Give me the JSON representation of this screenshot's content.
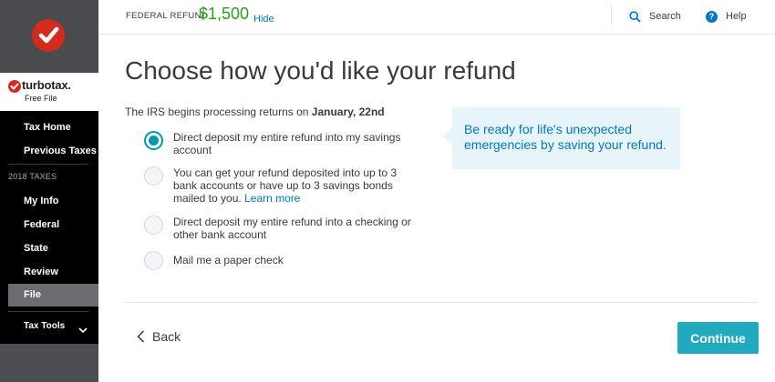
{
  "header": {
    "refund_label": "FEDERAL REFUND",
    "refund_amount": "$1,500",
    "hide_label": "Hide",
    "search_label": "Search",
    "help_label": "Help",
    "refund_color": "#2ca01c"
  },
  "sidebar": {
    "brand_name": "turbotax.",
    "brand_sub": "Free File",
    "items": [
      {
        "label": "Tax Home"
      },
      {
        "label": "Previous Taxes"
      }
    ],
    "section_label": "2018 TAXES",
    "section_items": [
      {
        "label": "My Info"
      },
      {
        "label": "Federal"
      },
      {
        "label": "State"
      },
      {
        "label": "Review"
      },
      {
        "label": "File",
        "active": true
      }
    ],
    "tools_label": "Tax Tools"
  },
  "main": {
    "title": "Choose how you'd like your refund",
    "intro_prefix": "The IRS begins processing returns on",
    "intro_date": "January, 22nd",
    "options": [
      {
        "label": "Direct deposit my entire refund into my savings account",
        "selected": true
      },
      {
        "label": "You can get your refund deposited into up to 3 bank accounts or have up to 3 savings bonds mailed to you.",
        "link": "Learn more",
        "selected": false
      },
      {
        "label": "Direct deposit my entire refund into a checking or other bank account",
        "selected": false
      },
      {
        "label": "Mail me a paper check",
        "selected": false
      }
    ],
    "callout": "Be ready for life's unexpected emergencies by saving your refund."
  },
  "footer": {
    "back_label": "Back",
    "continue_label": "Continue"
  },
  "colors": {
    "accent": "#21a9be",
    "brand_red": "#d52b1e",
    "link": "#0077c5"
  },
  "icons": [
    "checkmark-logo-icon",
    "search-icon",
    "help-icon",
    "chevron-down-icon",
    "chevron-left-icon"
  ]
}
